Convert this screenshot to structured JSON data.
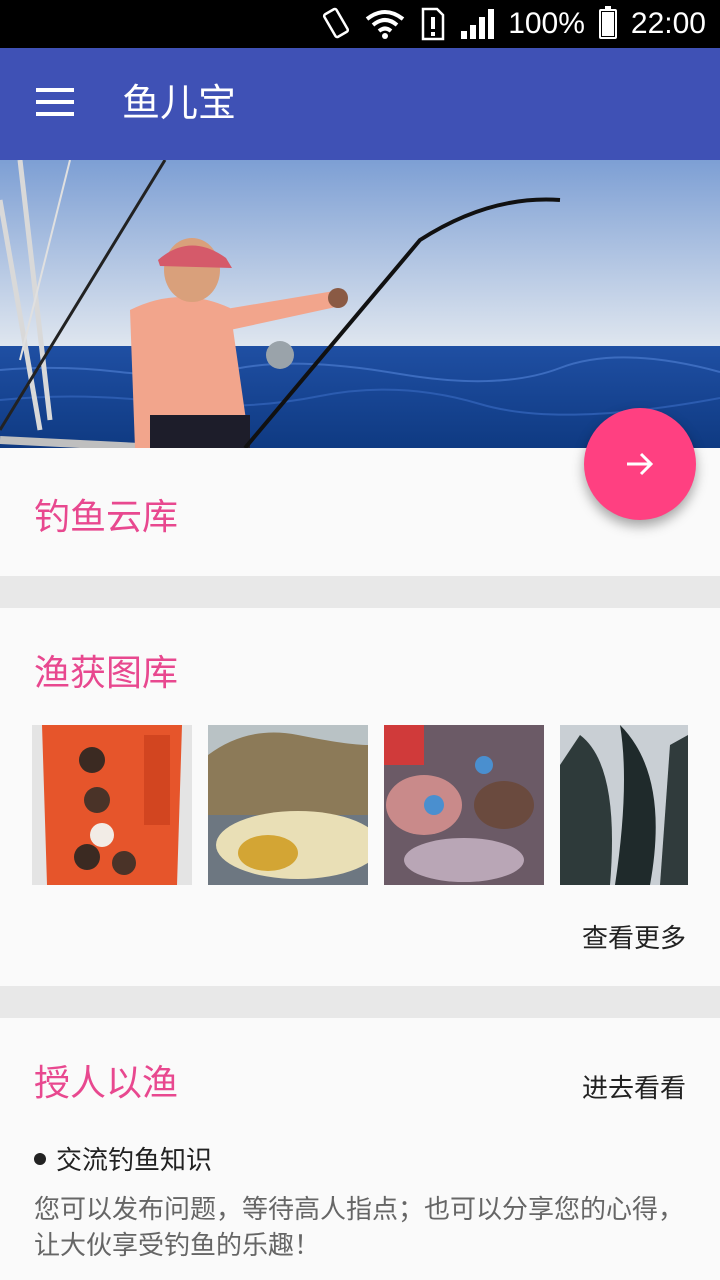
{
  "status_bar": {
    "battery_percent": "100%",
    "time": "22:00",
    "icons": [
      "screen-rotation-icon",
      "wifi-icon",
      "sim-alert-icon",
      "signal-icon",
      "battery-icon"
    ]
  },
  "toolbar": {
    "title": "鱼儿宝",
    "menu_icon": "menu-icon",
    "color": "#3f51b5"
  },
  "hero": {
    "image": "man-fishing-on-boat-photo"
  },
  "fab": {
    "icon": "arrow-right-icon",
    "color": "#ff4081"
  },
  "section_cloud": {
    "title": "钓鱼云库"
  },
  "section_gallery": {
    "title": "渔获图库",
    "thumbnails": [
      "snack-package-photo",
      "fish-on-rocks-photo",
      "crabs-and-fish-photo",
      "dark-fish-photo"
    ],
    "more_label": "查看更多"
  },
  "section_teach": {
    "title": "授人以渔",
    "enter_label": "进去看看",
    "bullet": "交流钓鱼知识",
    "description": "您可以发布问题，等待高人指点；也可以分享您的心得，让大伙享受钓鱼的乐趣！"
  },
  "accent_color": "#e8488f"
}
